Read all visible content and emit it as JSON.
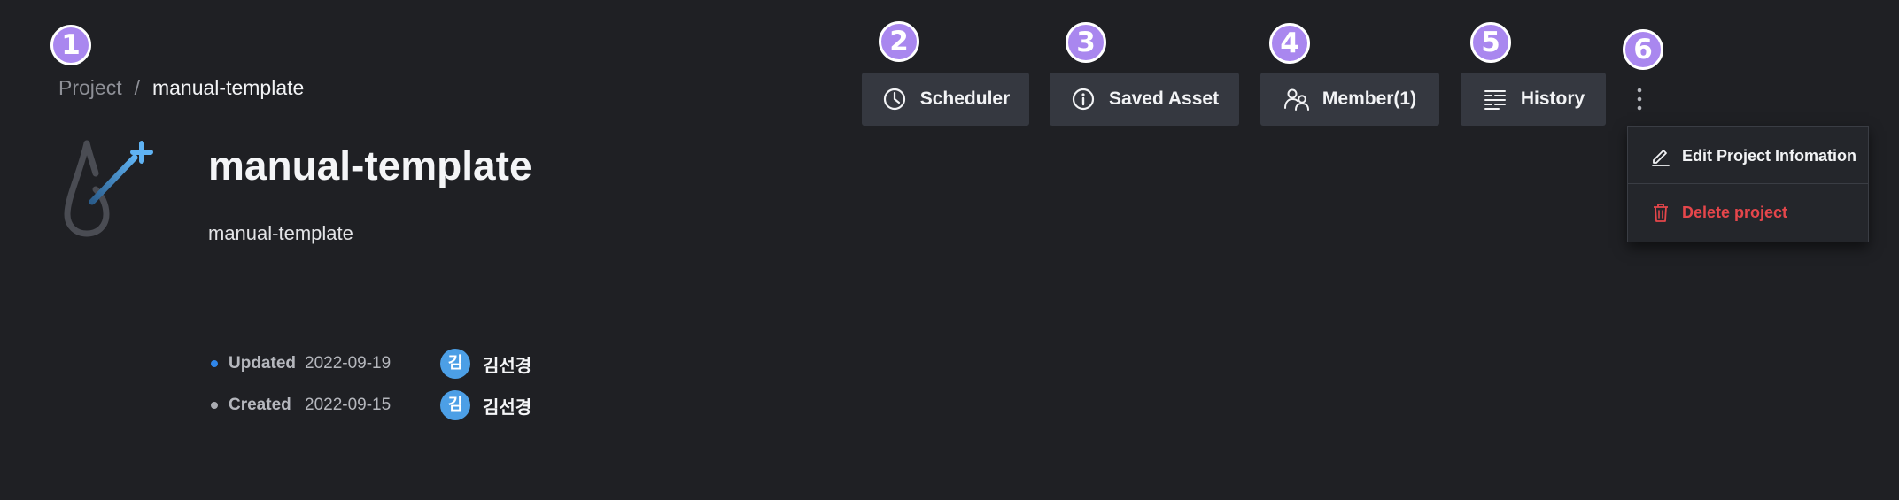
{
  "markers": [
    "1",
    "2",
    "3",
    "4",
    "5",
    "6"
  ],
  "breadcrumb": {
    "root": "Project",
    "separator": "/",
    "current": "manual-template"
  },
  "project": {
    "title": "manual-template",
    "description": "manual-template",
    "logo_icon": "droplet-sparkle-icon"
  },
  "meta": [
    {
      "label": "Updated",
      "date": "2022-09-19",
      "avatar_initial": "김",
      "user": "김선경",
      "dot_color": "#2f86ea"
    },
    {
      "label": "Created",
      "date": "2022-09-15",
      "avatar_initial": "김",
      "user": "김선경",
      "dot_color": "#a9abb1"
    }
  ],
  "toolbar": {
    "scheduler_label": "Scheduler",
    "saved_asset_label": "Saved Asset",
    "member_label": "Member(1)",
    "history_label": "History"
  },
  "menu": {
    "edit_label": "Edit Project Infomation",
    "delete_label": "Delete project"
  },
  "colors": {
    "background": "#1f2024",
    "button": "#353840",
    "marker": "#a987ef",
    "avatar": "#4c9fe6",
    "danger": "#e5464b"
  }
}
